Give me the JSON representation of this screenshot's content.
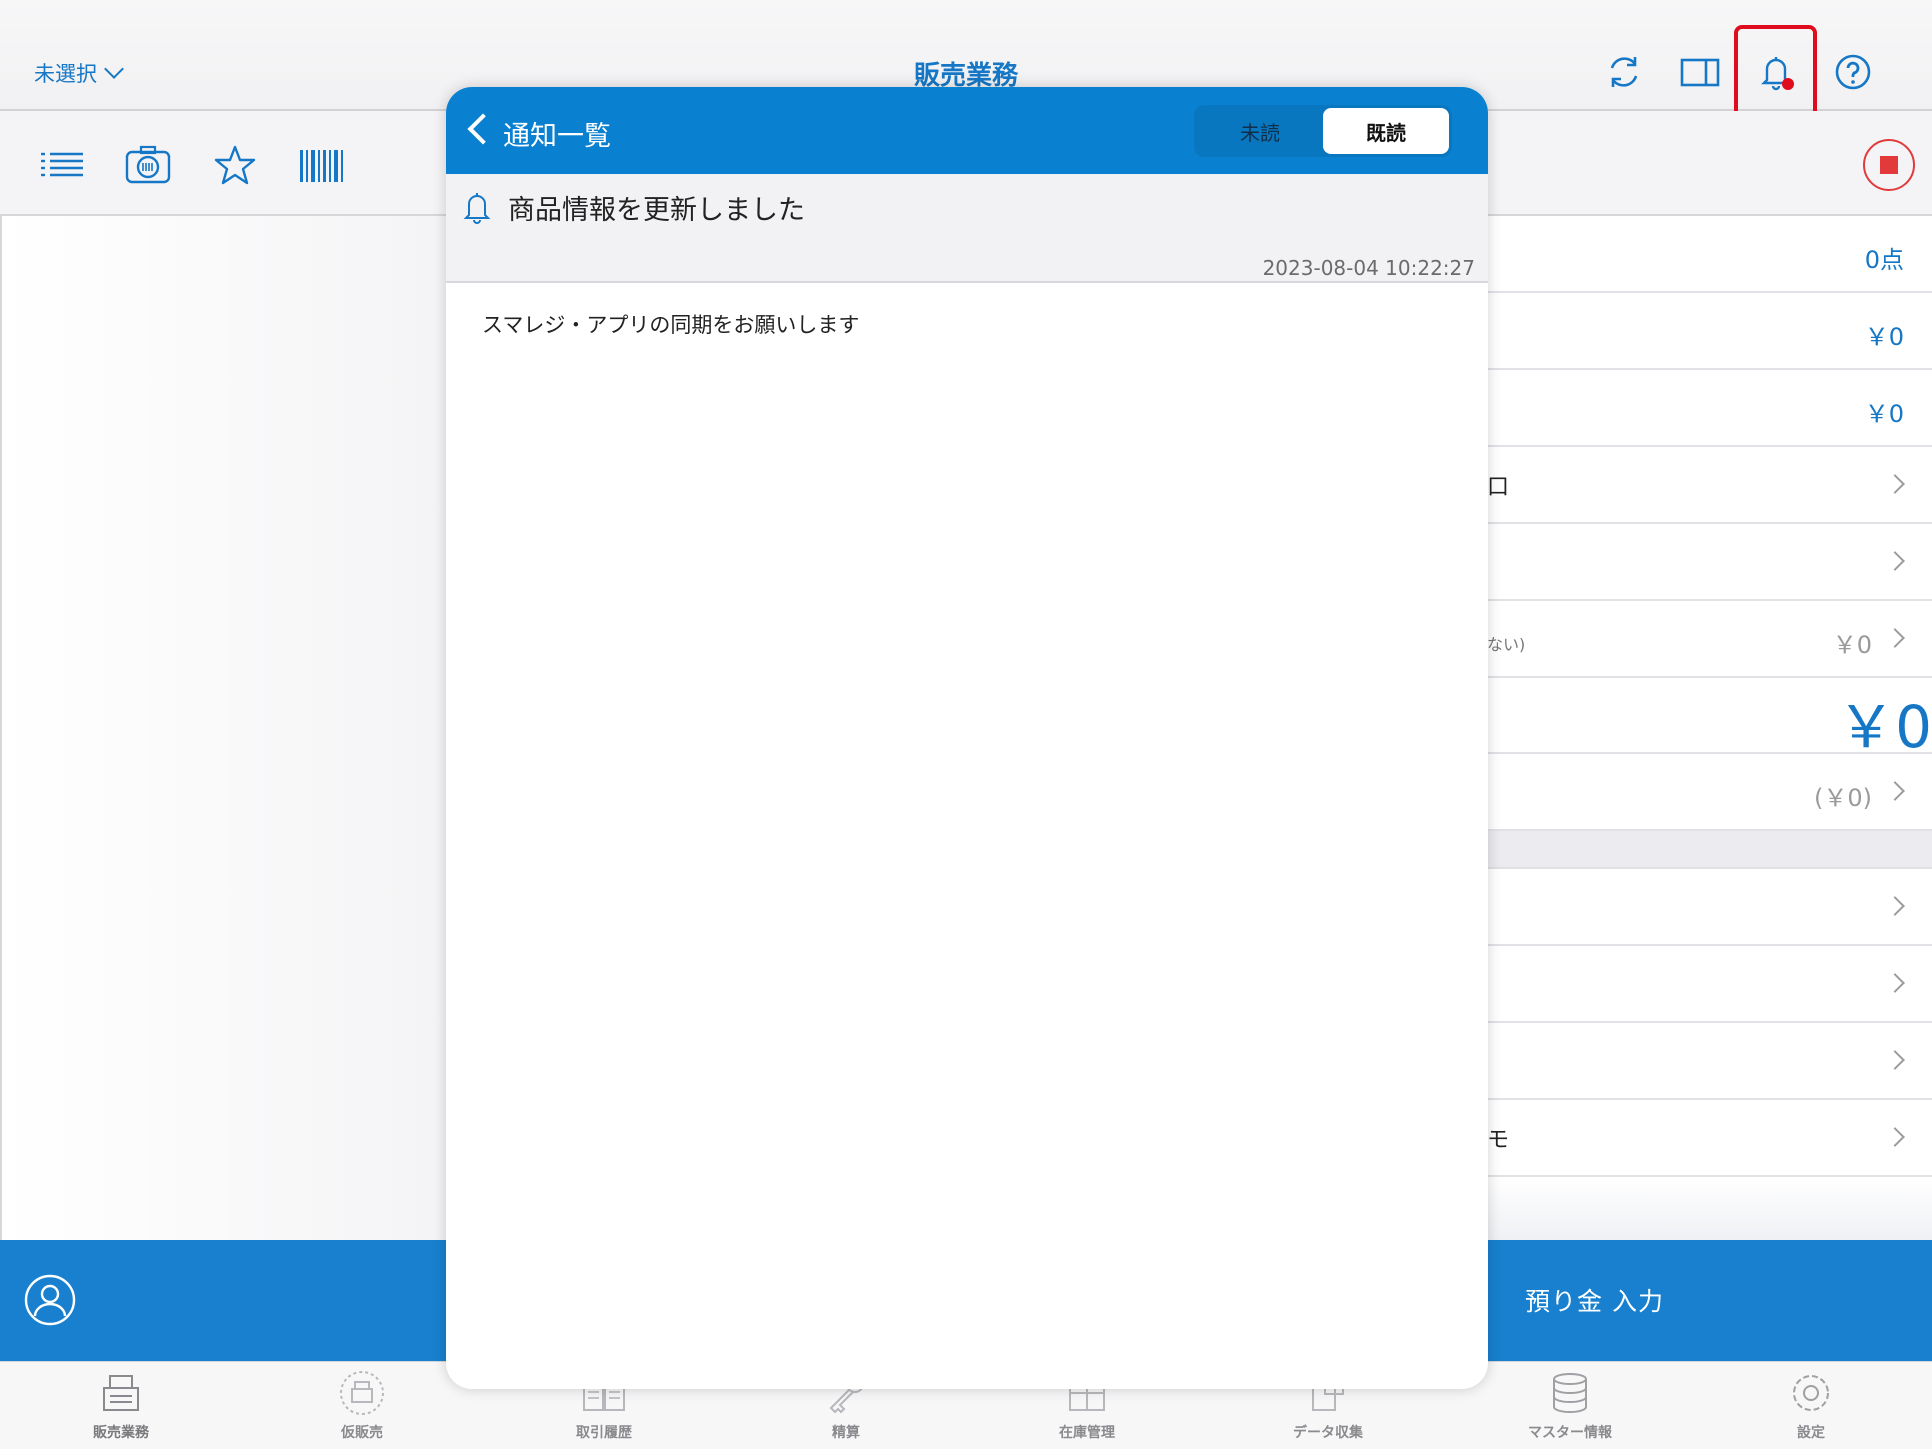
{
  "topbar": {
    "store_select": "未選択",
    "title": "販売業務",
    "icons": [
      "sync-icon",
      "split-view-icon",
      "bell-icon",
      "help-icon"
    ]
  },
  "toolbar": {
    "icons": [
      "list-icon",
      "camera-icon",
      "star-icon",
      "barcode-icon",
      "stop-icon"
    ]
  },
  "summary": {
    "items_count": "0点",
    "subtotal": "￥0",
    "tax": "￥0",
    "row4_partial": "口",
    "row6_partial": "ない)",
    "row6_value": "￥0",
    "total": "￥0",
    "row8_value": "(￥0)",
    "row12_partial": "モ"
  },
  "actionbar": {
    "deposit_label": "預り金 入力"
  },
  "tabs": [
    {
      "label": "販売業務",
      "icon": "register-icon"
    },
    {
      "label": "仮販売",
      "icon": "temp-sale-icon"
    },
    {
      "label": "取引履歴",
      "icon": "history-icon"
    },
    {
      "label": "精算",
      "icon": "settlement-icon"
    },
    {
      "label": "在庫管理",
      "icon": "inventory-icon"
    },
    {
      "label": "データ収集",
      "icon": "data-collection-icon"
    },
    {
      "label": "マスター情報",
      "icon": "master-data-icon"
    },
    {
      "label": "設定",
      "icon": "settings-icon"
    }
  ],
  "modal": {
    "title": "通知一覧",
    "segment": {
      "unread": "未読",
      "read": "既読",
      "selected": "既読"
    },
    "notification": {
      "title": "商品情報を更新しました",
      "timestamp": "2023-08-04 10:22:27",
      "body": "スマレジ・アプリの同期をお願いします"
    }
  },
  "colors": {
    "accent": "#1577c5",
    "header_blue": "#0a81d0",
    "action_blue": "#1880cf",
    "alert_red": "#e00b1c"
  }
}
